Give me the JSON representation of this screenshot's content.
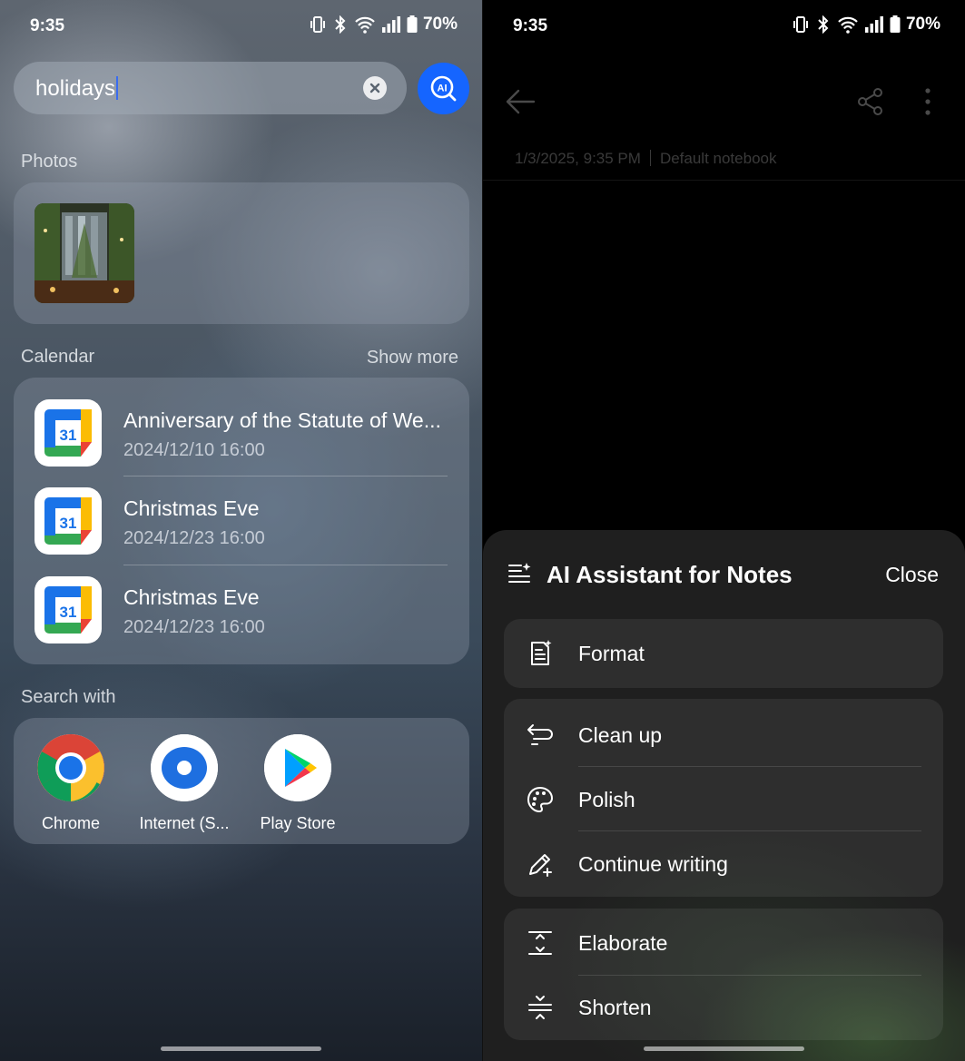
{
  "left": {
    "status": {
      "time": "9:35",
      "battery": "70%"
    },
    "search": {
      "value": "holidays"
    },
    "photos_label": "Photos",
    "calendar": {
      "label": "Calendar",
      "show_more": "Show more",
      "icon_day": "31",
      "events": [
        {
          "title": "Anniversary of the Statute of We...",
          "date": "2024/12/10 16:00"
        },
        {
          "title": "Christmas Eve",
          "date": "2024/12/23 16:00"
        },
        {
          "title": "Christmas Eve",
          "date": "2024/12/23 16:00"
        }
      ]
    },
    "search_with": {
      "label": "Search with",
      "apps": [
        {
          "label": "Chrome",
          "icon": "chrome-icon"
        },
        {
          "label": "Internet (S...",
          "icon": "samsung-internet-icon"
        },
        {
          "label": "Play Store",
          "icon": "play-store-icon"
        }
      ]
    },
    "ai_button": "AI"
  },
  "right": {
    "status": {
      "time": "9:35",
      "battery": "70%"
    },
    "note": {
      "timestamp": "1/3/2025, 9:35 PM",
      "notebook": "Default notebook"
    },
    "assistant": {
      "title": "AI Assistant for Notes",
      "close": "Close",
      "groups": [
        [
          {
            "label": "Format",
            "icon": "format-icon"
          }
        ],
        [
          {
            "label": "Clean up",
            "icon": "clean-up-icon"
          },
          {
            "label": "Polish",
            "icon": "palette-icon"
          },
          {
            "label": "Continue writing",
            "icon": "pencil-plus-icon"
          }
        ],
        [
          {
            "label": "Elaborate",
            "icon": "expand-icon"
          },
          {
            "label": "Shorten",
            "icon": "shorten-icon"
          }
        ]
      ]
    }
  },
  "colors": {
    "ai_blue": "#1565ff",
    "caret": "#3a6cf0"
  }
}
